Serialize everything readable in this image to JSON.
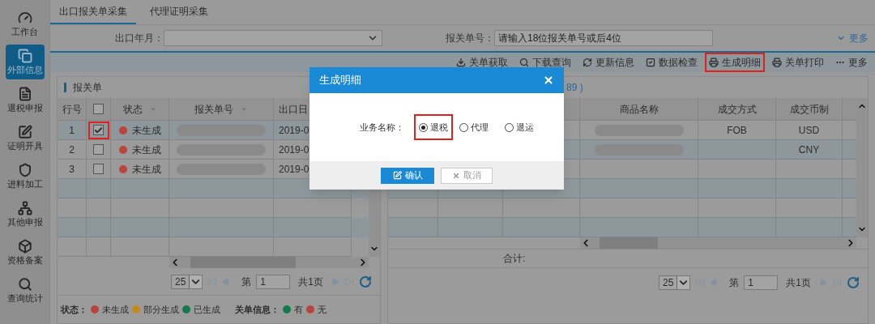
{
  "sidebar": {
    "items": [
      {
        "label": "工作台",
        "selected": false
      },
      {
        "label": "外部信息",
        "selected": true
      },
      {
        "label": "退税申报",
        "selected": false
      },
      {
        "label": "证明开具",
        "selected": false
      },
      {
        "label": "进料加工",
        "selected": false
      },
      {
        "label": "其他申报",
        "selected": false
      },
      {
        "label": "资格备案",
        "selected": false
      },
      {
        "label": "查询统计",
        "selected": false
      }
    ]
  },
  "tabs": [
    {
      "label": "出口报关单采集",
      "selected": true
    },
    {
      "label": "代理证明采集",
      "selected": false
    }
  ],
  "filters": [
    {
      "kind": "select",
      "label": "出口年月："
    },
    {
      "kind": "input",
      "label": "报关单号：",
      "placeholder": "请输入18位报关单号或后4位"
    }
  ],
  "more_link": "更多",
  "toolbar": [
    {
      "label": "关单获取",
      "highlighted": false
    },
    {
      "label": "下载查询",
      "highlighted": false
    },
    {
      "label": "更新信息",
      "highlighted": false
    },
    {
      "label": "数据检查",
      "highlighted": false
    },
    {
      "label": "生成明细",
      "highlighted": true
    },
    {
      "label": "关单打印",
      "highlighted": false
    },
    {
      "label": "更多",
      "highlighted": false
    }
  ],
  "left_panel": {
    "title": "报关单",
    "columns": [
      {
        "kind": "number",
        "label": "行号"
      },
      {
        "kind": "checkbox",
        "checked": false
      },
      {
        "kind": "status",
        "label": "状态",
        "sortable": true
      },
      {
        "kind": "text",
        "label": "报关单号",
        "sortable": true
      },
      {
        "kind": "text",
        "label": "出口日"
      }
    ],
    "rows": [
      {
        "number": "1",
        "checked": true,
        "selected": true,
        "highlighted": true,
        "status": "未生成",
        "color": "#b8453b",
        "date": "2019-0"
      },
      {
        "number": "2",
        "checked": false,
        "selected": false,
        "highlighted": false,
        "status": "未生成",
        "color": "#b8453b",
        "date": "2019-0"
      },
      {
        "number": "3",
        "checked": false,
        "selected": false,
        "highlighted": false,
        "status": "未生成",
        "color": "#b8453b",
        "date": "2019-0"
      }
    ],
    "pager": {
      "page_size": "25",
      "page_label": "第",
      "page": "1",
      "total": "共1页"
    },
    "legend": {
      "status_label": "状态：",
      "status_items": [
        {
          "label": "未生成",
          "color": "#b8453b"
        },
        {
          "label": "部分生成",
          "color": "#c58a1c"
        },
        {
          "label": "已生成",
          "color": "#127a4c"
        }
      ],
      "customs_label": "关单信息：",
      "customs_items": [
        {
          "label": "有",
          "color": "#127a4c"
        },
        {
          "label": "无",
          "color": "#b8453b"
        }
      ]
    }
  },
  "right_panel": {
    "title_fragment": "89 )",
    "columns": [
      "商品名称",
      "成交方式",
      "成交币制"
    ],
    "rows": [
      {
        "terms": "FOB",
        "currency": "USD"
      },
      {
        "currency": "CNY"
      }
    ],
    "total_label": "合计:",
    "pager": {
      "page_size": "25",
      "page_label": "第",
      "page": "1",
      "total": "共1页"
    }
  },
  "dialog": {
    "title": "生成明细",
    "field_label": "业务名称：",
    "options": [
      {
        "label": "退税",
        "selected": true,
        "highlighted": true
      },
      {
        "label": "代理",
        "selected": false,
        "highlighted": false
      },
      {
        "label": "退运",
        "selected": false,
        "highlighted": false
      }
    ],
    "buttons": [
      {
        "kind": "primary",
        "label": "确认"
      },
      {
        "kind": "secondary",
        "label": "取消"
      }
    ]
  }
}
